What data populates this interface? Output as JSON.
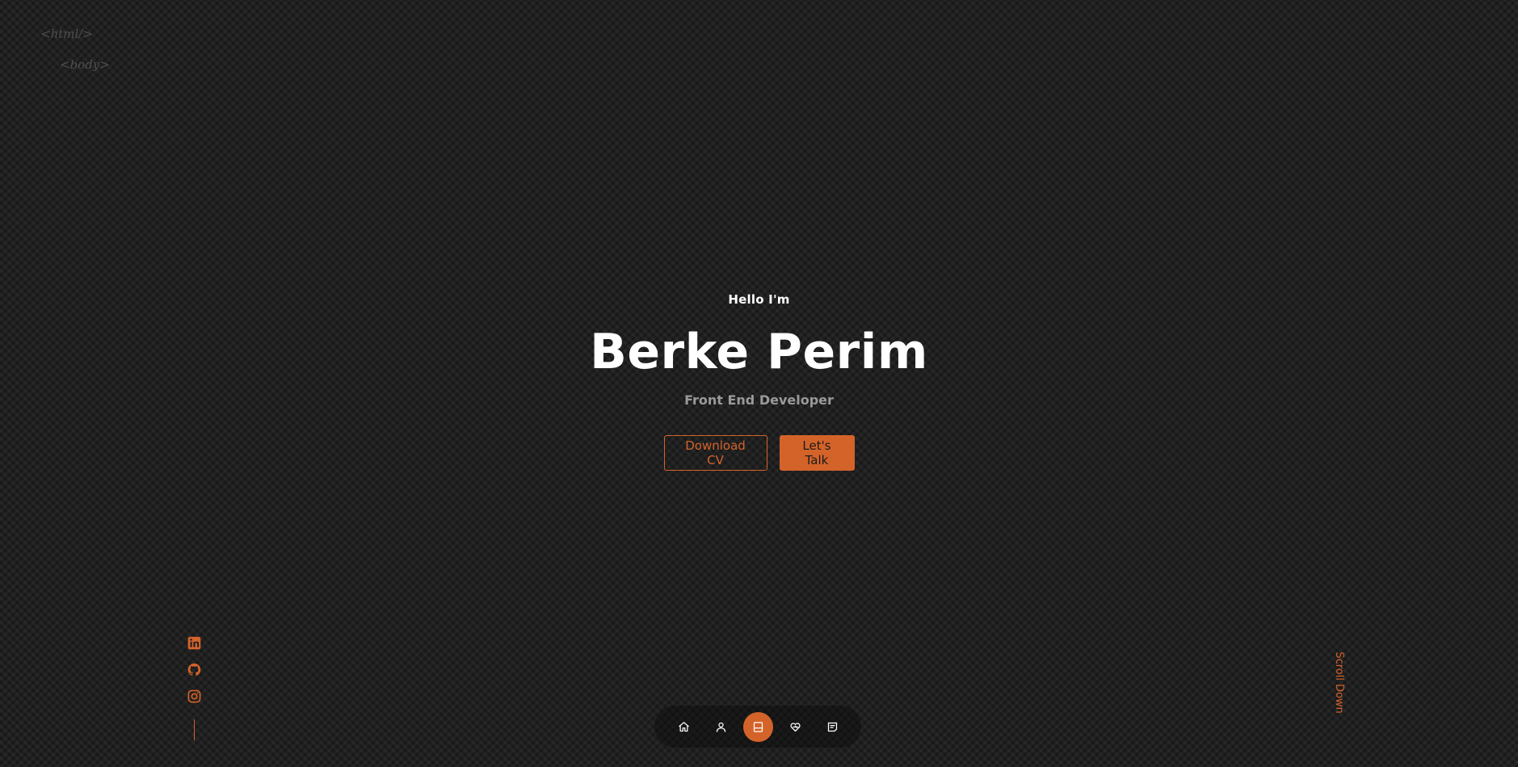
{
  "code_tags": {
    "html": "<html/>",
    "body": "<body>"
  },
  "hero": {
    "greeting": "Hello I'm",
    "name": "Berke Perim",
    "role": "Front End Developer",
    "download_cv_label": "Download CV",
    "lets_talk_label": "Let's Talk"
  },
  "socials": [
    {
      "icon": "linkedin-icon"
    },
    {
      "icon": "github-icon"
    },
    {
      "icon": "instagram-icon"
    }
  ],
  "scroll_down_label": "Scroll Down",
  "nav": {
    "items": [
      {
        "icon": "home-icon",
        "active": false
      },
      {
        "icon": "user-icon",
        "active": false
      },
      {
        "icon": "book-icon",
        "active": true
      },
      {
        "icon": "services-icon",
        "active": false
      },
      {
        "icon": "message-icon",
        "active": false
      }
    ]
  },
  "colors": {
    "accent": "#d4632a",
    "background": "#202020",
    "text_primary": "#ffffff",
    "text_muted": "#9a9a9a"
  }
}
